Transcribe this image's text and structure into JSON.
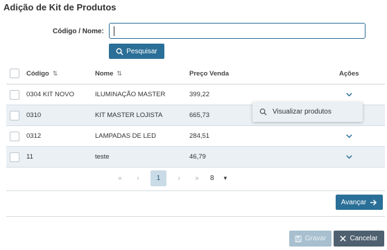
{
  "dialog": {
    "title": "Adição de Kit de Produtos"
  },
  "search": {
    "label": "Código / Nome:",
    "value": "",
    "button_label": "Pesquisar"
  },
  "table": {
    "headers": {
      "codigo": "Código",
      "nome": "Nome",
      "preco": "Preço Venda",
      "acoes": "Ações"
    },
    "rows": [
      {
        "codigo": "0304 KIT NOVO",
        "nome": "ILUMINAÇÃO MASTER",
        "preco": "399,22"
      },
      {
        "codigo": "0310",
        "nome": "KIT MASTER LOJISTA",
        "preco": "665,73"
      },
      {
        "codigo": "0312",
        "nome": "LAMPADAS DE LED",
        "preco": "284,51"
      },
      {
        "codigo": "11",
        "nome": "teste",
        "preco": "46,79"
      }
    ]
  },
  "row_menu": {
    "item_label": "Visualizar produtos"
  },
  "pagination": {
    "current_page": "1",
    "page_size": "8"
  },
  "footer": {
    "next_label": "Avançar",
    "save_label": "Gravar",
    "cancel_label": "Cancelar"
  },
  "colors": {
    "primary": "#2a6f97",
    "row_alt": "#eaf0f4",
    "cancel": "#4f6170",
    "disabled": "#a7bfce"
  }
}
